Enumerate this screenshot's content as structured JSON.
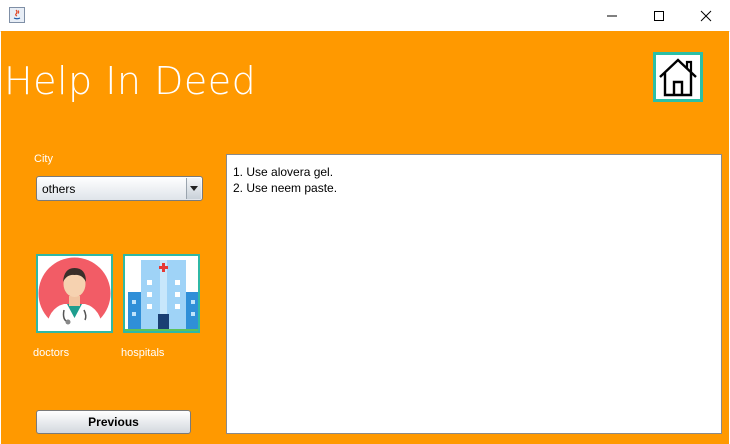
{
  "window": {
    "controls": {
      "minimize_icon": "minimize-icon",
      "maximize_icon": "maximize-icon",
      "close_icon": "close-icon"
    }
  },
  "app": {
    "title": "Help In Deed",
    "home_icon": "home-icon"
  },
  "city": {
    "label": "City",
    "selected": "others"
  },
  "categories": [
    {
      "label": "doctors",
      "icon": "doctor-icon"
    },
    {
      "label": "hospitals",
      "icon": "hospital-icon"
    }
  ],
  "remedies": {
    "lines": [
      "1. Use alovera gel.",
      "2. Use neem paste."
    ]
  },
  "buttons": {
    "previous": "Previous"
  },
  "colors": {
    "background": "#ff9900",
    "accent_border": "#2bbfa6",
    "text_light": "#ffffff"
  }
}
